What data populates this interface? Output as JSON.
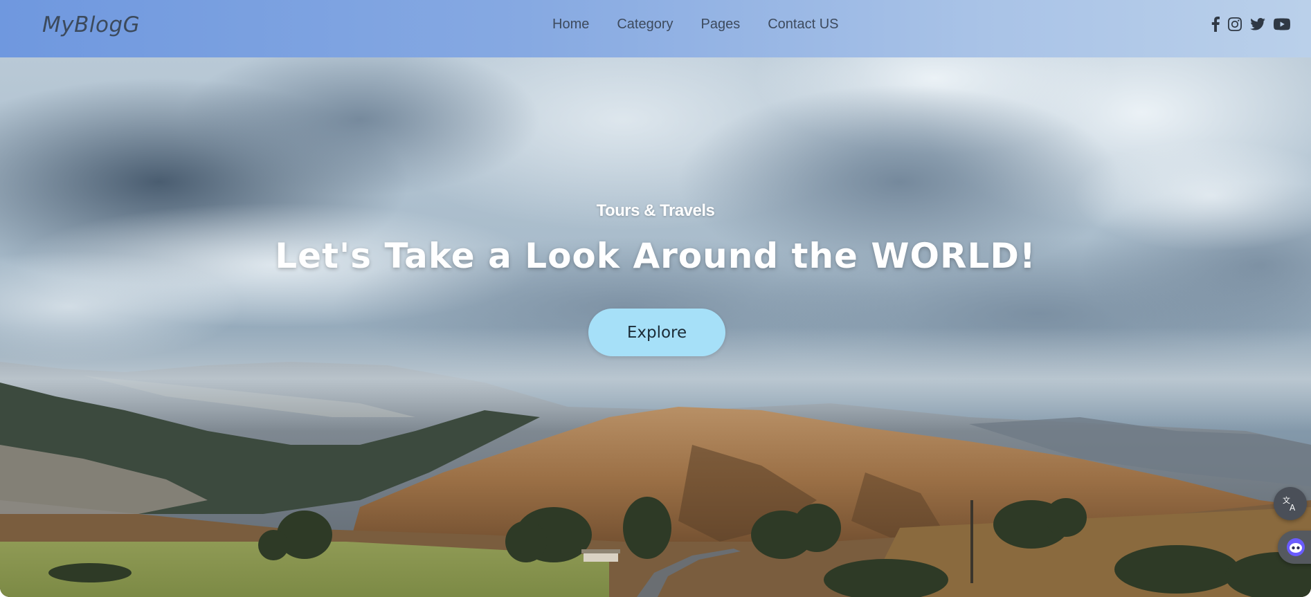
{
  "header": {
    "logo": "MyBlogG",
    "nav": [
      {
        "label": "Home"
      },
      {
        "label": "Category"
      },
      {
        "label": "Pages"
      },
      {
        "label": "Contact US"
      }
    ],
    "socials": [
      "facebook-icon",
      "instagram-icon",
      "twitter-icon",
      "youtube-icon"
    ]
  },
  "hero": {
    "kicker": "Tours & Travels",
    "headline": "Let's Take a Look Around the WORLD!",
    "cta_label": "Explore",
    "background": "landscape-photo-cloudy-hills-road"
  },
  "floating": {
    "translate_icon": "translate-icon",
    "assistant_icon": "assistant-icon"
  },
  "colors": {
    "nav_gradient_start": "#6f98df",
    "nav_gradient_end": "#bad0ea",
    "cta_bg": "#a6e0f8",
    "text_dark": "#3d4a5d"
  }
}
